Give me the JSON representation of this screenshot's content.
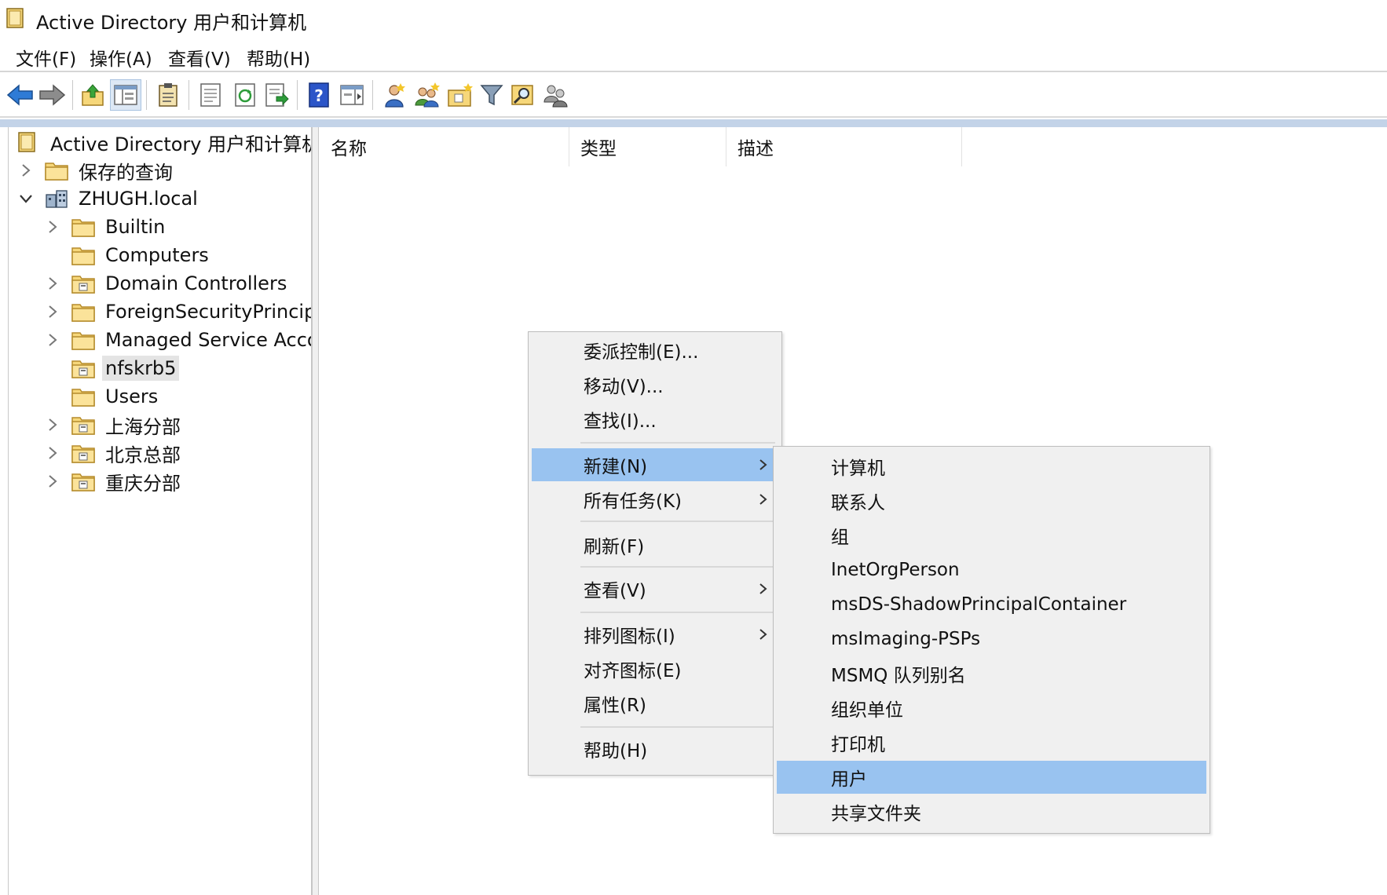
{
  "window": {
    "title": "Active Directory 用户和计算机",
    "icon": "ad-console-icon"
  },
  "menubar": [
    {
      "label": "文件(F)"
    },
    {
      "label": "操作(A)"
    },
    {
      "label": "查看(V)"
    },
    {
      "label": "帮助(H)"
    }
  ],
  "toolbar": [
    {
      "icon": "back-arrow-icon"
    },
    {
      "icon": "forward-arrow-icon"
    },
    {
      "icon": "up-folder-icon"
    },
    {
      "icon": "show-hide-tree-icon"
    },
    {
      "icon": "clipboard-icon"
    },
    {
      "icon": "properties-icon"
    },
    {
      "icon": "refresh-icon"
    },
    {
      "icon": "export-list-icon"
    },
    {
      "icon": "help-icon"
    },
    {
      "icon": "action-pane-icon"
    },
    {
      "icon": "new-user-icon"
    },
    {
      "icon": "new-group-icon"
    },
    {
      "icon": "new-ou-icon"
    },
    {
      "icon": "filter-icon"
    },
    {
      "icon": "find-icon"
    },
    {
      "icon": "add-to-group-icon"
    }
  ],
  "tree": {
    "root": "Active Directory 用户和计算机",
    "items": [
      {
        "label": "保存的查询",
        "level": 1,
        "expander": "collapsed",
        "icon": "folder-icon"
      },
      {
        "label": "ZHUGH.local",
        "level": 1,
        "expander": "expanded",
        "icon": "domain-icon"
      },
      {
        "label": "Builtin",
        "level": 2,
        "expander": "collapsed",
        "icon": "folder-icon"
      },
      {
        "label": "Computers",
        "level": 2,
        "expander": "none",
        "icon": "folder-icon"
      },
      {
        "label": "Domain Controllers",
        "level": 2,
        "expander": "collapsed",
        "icon": "ou-icon"
      },
      {
        "label": "ForeignSecurityPrincipals",
        "level": 2,
        "expander": "collapsed",
        "icon": "folder-icon"
      },
      {
        "label": "Managed Service Accounts",
        "level": 2,
        "expander": "collapsed",
        "icon": "folder-icon"
      },
      {
        "label": "nfskrb5",
        "level": 2,
        "expander": "none",
        "icon": "ou-icon",
        "selected": true
      },
      {
        "label": "Users",
        "level": 2,
        "expander": "none",
        "icon": "folder-icon"
      },
      {
        "label": "上海分部",
        "level": 2,
        "expander": "collapsed",
        "icon": "ou-icon"
      },
      {
        "label": "北京总部",
        "level": 2,
        "expander": "collapsed",
        "icon": "ou-icon"
      },
      {
        "label": "重庆分部",
        "level": 2,
        "expander": "collapsed",
        "icon": "ou-icon"
      }
    ]
  },
  "list": {
    "columns": [
      {
        "label": "名称"
      },
      {
        "label": "类型"
      },
      {
        "label": "描述"
      }
    ]
  },
  "context_menu": {
    "items": [
      {
        "label": "委派控制(E)..."
      },
      {
        "label": "移动(V)..."
      },
      {
        "label": "查找(I)..."
      },
      {
        "label": "新建(N)",
        "submenu": true,
        "highlighted": true
      },
      {
        "label": "所有任务(K)",
        "submenu": true
      },
      {
        "label": "刷新(F)"
      },
      {
        "label": "查看(V)",
        "submenu": true
      },
      {
        "label": "排列图标(I)",
        "submenu": true
      },
      {
        "label": "对齐图标(E)"
      },
      {
        "label": "属性(R)"
      },
      {
        "label": "帮助(H)"
      }
    ]
  },
  "submenu_new": {
    "items": [
      {
        "label": "计算机"
      },
      {
        "label": "联系人"
      },
      {
        "label": "组"
      },
      {
        "label": "InetOrgPerson"
      },
      {
        "label": "msDS-ShadowPrincipalContainer"
      },
      {
        "label": "msImaging-PSPs"
      },
      {
        "label": "MSMQ 队列别名"
      },
      {
        "label": "组织单位"
      },
      {
        "label": "打印机"
      },
      {
        "label": "用户",
        "highlighted": true
      },
      {
        "label": "共享文件夹"
      }
    ]
  },
  "colors": {
    "highlight": "#99c3f0",
    "menu_bg": "#f0f0f0",
    "strip": "#c3d3e8",
    "folder": "#f6d77a",
    "selected_bg": "#e4e4e4"
  }
}
